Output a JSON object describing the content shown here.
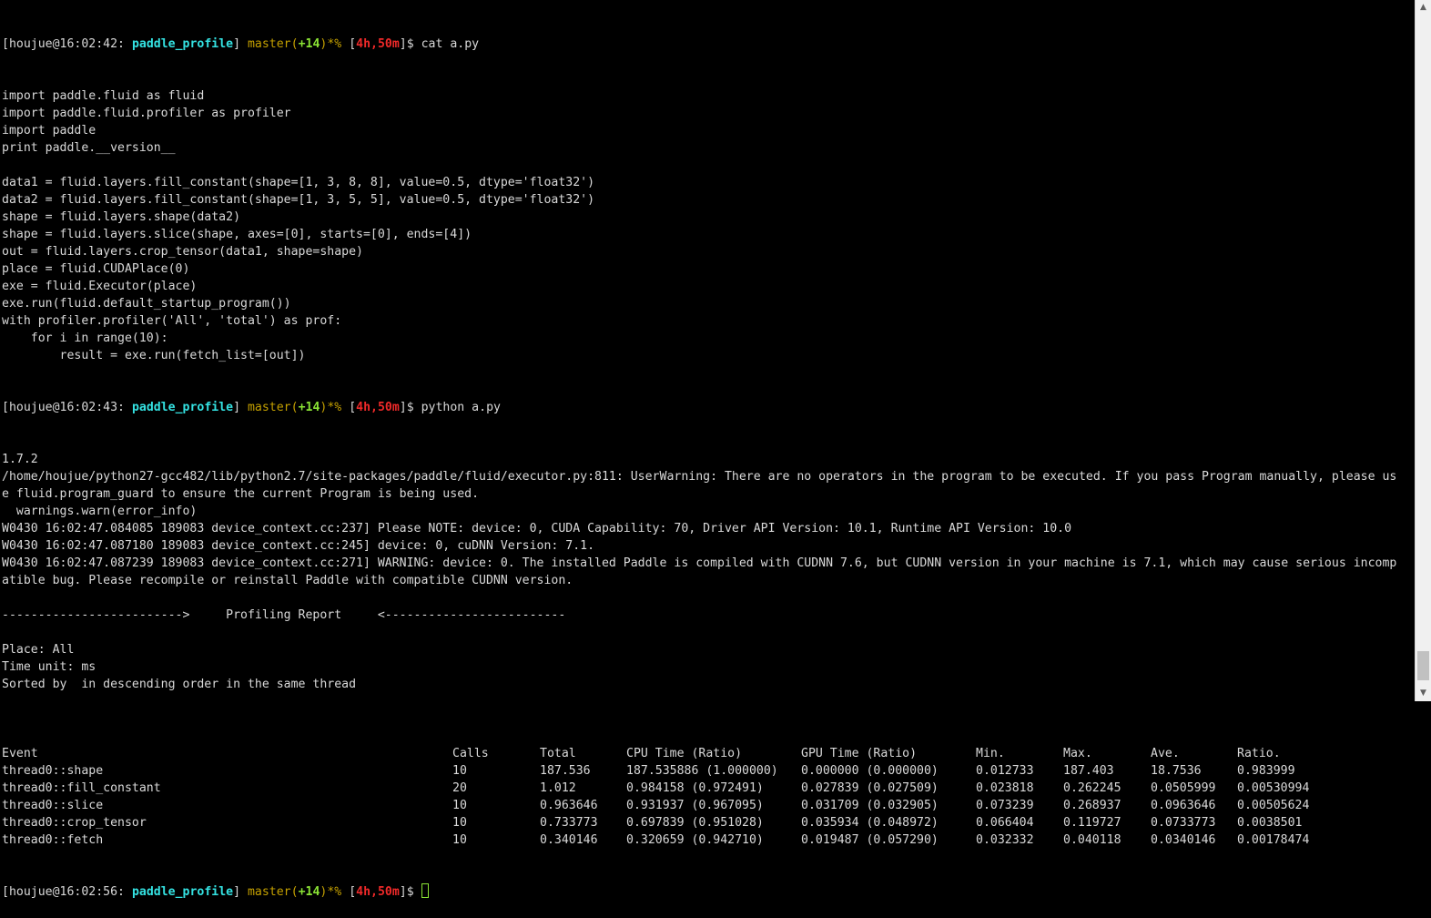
{
  "prompt": {
    "host": "[houjue@16:02:",
    "dir": "paddle_profile",
    "branch": "master",
    "count": "+14",
    "marks": "*%",
    "time": "4h,50m"
  },
  "cmd1": {
    "seconds": "42:",
    "command": "cat a.py"
  },
  "code_lines": [
    "import paddle.fluid as fluid",
    "import paddle.fluid.profiler as profiler",
    "import paddle",
    "print paddle.__version__",
    "",
    "data1 = fluid.layers.fill_constant(shape=[1, 3, 8, 8], value=0.5, dtype='float32')",
    "data2 = fluid.layers.fill_constant(shape=[1, 3, 5, 5], value=0.5, dtype='float32')",
    "shape = fluid.layers.shape(data2)",
    "shape = fluid.layers.slice(shape, axes=[0], starts=[0], ends=[4])",
    "out = fluid.layers.crop_tensor(data1, shape=shape)",
    "place = fluid.CUDAPlace(0)",
    "exe = fluid.Executor(place)",
    "exe.run(fluid.default_startup_program())",
    "with profiler.profiler('All', 'total') as prof:",
    "    for i in range(10):",
    "        result = exe.run(fetch_list=[out])"
  ],
  "cmd2": {
    "seconds": "43:",
    "command": "python a.py"
  },
  "output_lines": [
    "1.7.2",
    "/home/houjue/python27-gcc482/lib/python2.7/site-packages/paddle/fluid/executor.py:811: UserWarning: There are no operators in the program to be executed. If you pass Program manually, please us",
    "e fluid.program_guard to ensure the current Program is being used.",
    "  warnings.warn(error_info)",
    "W0430 16:02:47.084085 189083 device_context.cc:237] Please NOTE: device: 0, CUDA Capability: 70, Driver API Version: 10.1, Runtime API Version: 10.0",
    "W0430 16:02:47.087180 189083 device_context.cc:245] device: 0, cuDNN Version: 7.1.",
    "W0430 16:02:47.087239 189083 device_context.cc:271] WARNING: device: 0. The installed Paddle is compiled with CUDNN 7.6, but CUDNN version in your machine is 7.1, which may cause serious incomp",
    "atible bug. Please recompile or reinstall Paddle with compatible CUDNN version.",
    "",
    "------------------------->     Profiling Report     <-------------------------",
    "",
    "Place: All",
    "Time unit: ms",
    "Sorted by  in descending order in the same thread",
    ""
  ],
  "profile_table": {
    "headers": [
      "Event",
      "Calls",
      "Total",
      "CPU Time (Ratio)",
      "GPU Time (Ratio)",
      "Min.",
      "Max.",
      "Ave.",
      "Ratio."
    ],
    "rows": [
      [
        "thread0::shape",
        "10",
        "187.536",
        "187.535886 (1.000000)",
        "0.000000 (0.000000)",
        "0.012733",
        "187.403",
        "18.7536",
        "0.983999"
      ],
      [
        "thread0::fill_constant",
        "20",
        "1.012",
        "0.984158 (0.972491)",
        "0.027839 (0.027509)",
        "0.023818",
        "0.262245",
        "0.0505999",
        "0.00530994"
      ],
      [
        "thread0::slice",
        "10",
        "0.963646",
        "0.931937 (0.967095)",
        "0.031709 (0.032905)",
        "0.073239",
        "0.268937",
        "0.0963646",
        "0.00505624"
      ],
      [
        "thread0::crop_tensor",
        "10",
        "0.733773",
        "0.697839 (0.951028)",
        "0.035934 (0.048972)",
        "0.066404",
        "0.119727",
        "0.0733773",
        "0.0038501"
      ],
      [
        "thread0::fetch",
        "10",
        "0.340146",
        "0.320659 (0.942710)",
        "0.019487 (0.057290)",
        "0.032332",
        "0.040118",
        "0.0340146",
        "0.00178474"
      ]
    ]
  },
  "cmd3": {
    "seconds": "56:",
    "command": ""
  },
  "icons": {
    "scroll_up": "triangle-up",
    "scroll_down": "triangle-down"
  },
  "colors": {
    "background": "#000000",
    "foreground": "#d9d9d9",
    "dir": "#34e2e2",
    "branch": "#c4a000",
    "count": "#8ae234",
    "time": "#ef2929"
  }
}
